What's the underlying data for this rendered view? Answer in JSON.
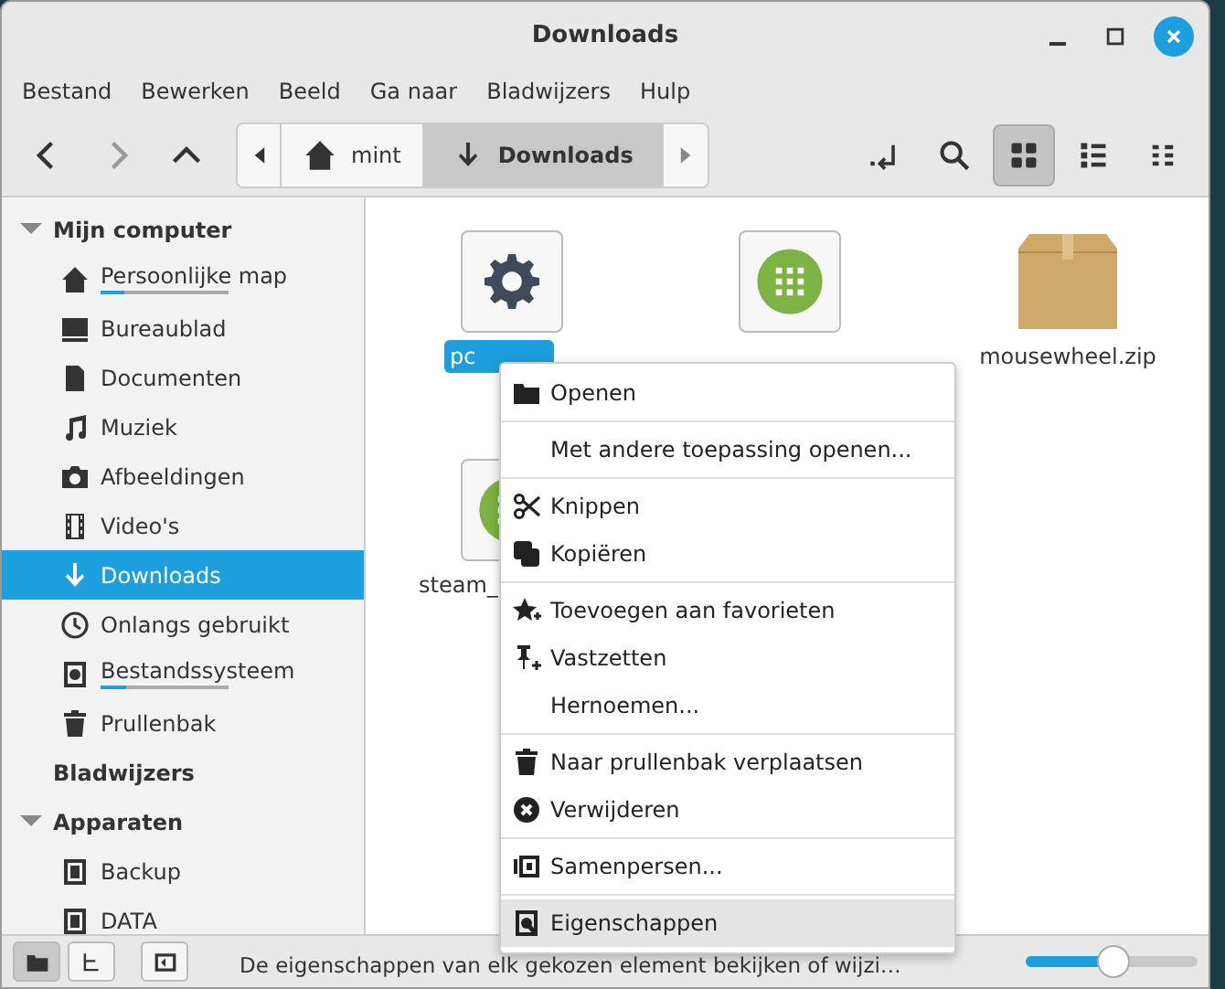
{
  "window": {
    "title": "Downloads"
  },
  "menubar": [
    "Bestand",
    "Bewerken",
    "Beeld",
    "Ga naar",
    "Bladwijzers",
    "Hulp"
  ],
  "toolbar": {
    "back_disabled": false,
    "forward_disabled": true,
    "path": [
      {
        "label": "mint",
        "selected": false
      },
      {
        "label": "Downloads",
        "selected": true
      }
    ],
    "views": [
      {
        "selected": true
      },
      {
        "selected": false
      },
      {
        "selected": false
      }
    ]
  },
  "sidebar": [
    {
      "title": "Mijn computer",
      "expanded": true,
      "items": [
        {
          "label": "Persoonlijke map",
          "selected": false,
          "level": 0.18
        },
        {
          "label": "Bureaublad",
          "selected": false
        },
        {
          "label": "Documenten",
          "selected": false
        },
        {
          "label": "Muziek",
          "selected": false
        },
        {
          "label": "Afbeeldingen",
          "selected": false
        },
        {
          "label": "Video's",
          "selected": false
        },
        {
          "label": "Downloads",
          "selected": true
        },
        {
          "label": "Onlangs gebruikt",
          "selected": false
        },
        {
          "label": "Bestandssysteem",
          "selected": false,
          "level": 0.2
        },
        {
          "label": "Prullenbak",
          "selected": false
        }
      ]
    },
    {
      "title": "Bladwijzers"
    },
    {
      "title": "Apparaten",
      "expanded": true,
      "items": [
        {
          "label": "Backup",
          "selected": false
        },
        {
          "label": "DATA",
          "selected": false
        }
      ]
    }
  ],
  "files": [
    {
      "name": "pc",
      "kind": "settings",
      "selected": true
    },
    {
      "kind": "app"
    },
    {
      "name": "mousewheel.zip",
      "kind": "archive",
      "selected": false
    },
    {
      "name": "steam_",
      "kind": "app",
      "selected": false
    }
  ],
  "context_menu": [
    [
      {
        "label": "Openen",
        "selected": false
      }
    ],
    [
      {
        "label": "Met andere toepassing openen...",
        "selected": false
      }
    ],
    [
      {
        "label": "Knippen",
        "selected": false
      },
      {
        "label": "Kopiëren",
        "selected": false
      }
    ],
    [
      {
        "label": "Toevoegen aan favorieten",
        "selected": false
      },
      {
        "label": "Vastzetten",
        "selected": false
      },
      {
        "label": "Hernoemen...",
        "selected": false
      }
    ],
    [
      {
        "label": "Naar prullenbak verplaatsen",
        "selected": false
      },
      {
        "label": "Verwijderen",
        "selected": false
      }
    ],
    [
      {
        "label": "Samenpersen...",
        "selected": false
      }
    ],
    [
      {
        "label": "Eigenschappen",
        "selected": true
      }
    ]
  ],
  "status_bar": {
    "panes": [
      {
        "selected": true
      },
      {
        "selected": false
      }
    ],
    "text": "De eigenschappen van elk gekozen element bekijken of wijzi…",
    "zoom": {
      "level": 0.5
    }
  }
}
